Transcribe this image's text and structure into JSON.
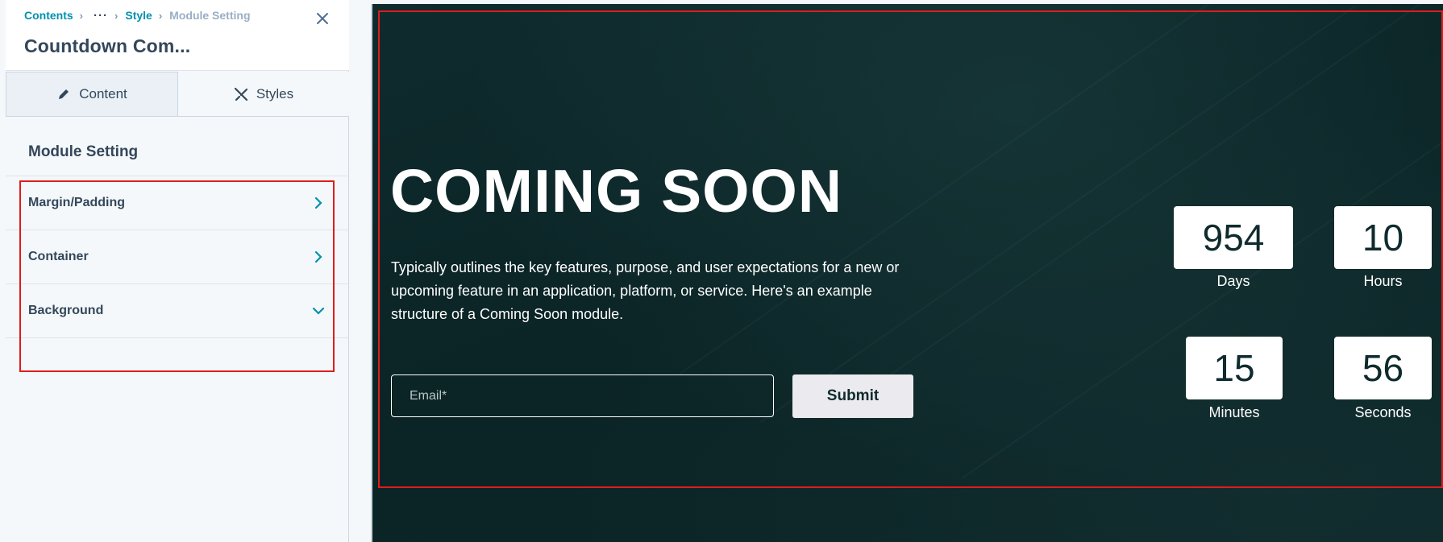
{
  "sidebar": {
    "breadcrumb": {
      "items": [
        "Contents",
        "Style"
      ],
      "ellipsis": "···",
      "current": "Module Setting"
    },
    "title": "Countdown Com...",
    "tabs": [
      {
        "label": "Content",
        "icon": "pencil-icon"
      },
      {
        "label": "Styles",
        "icon": "brush-icon"
      }
    ],
    "section_title": "Module Setting",
    "accordion": [
      {
        "label": "Margin/Padding",
        "state": "collapsed"
      },
      {
        "label": "Container",
        "state": "collapsed"
      },
      {
        "label": "Background",
        "state": "expanded"
      }
    ]
  },
  "preview": {
    "heading": "COMING SOON",
    "description": "Typically outlines the key features, purpose, and user expectations for a new or upcoming feature in an application, platform, or service. Here's an example structure of a Coming Soon module.",
    "email_placeholder": "Email*",
    "submit_label": "Submit",
    "countdown": [
      {
        "value": "954",
        "label": "Days"
      },
      {
        "value": "10",
        "label": "Hours"
      },
      {
        "value": "15",
        "label": "Minutes"
      },
      {
        "value": "56",
        "label": "Seconds"
      }
    ]
  },
  "colors": {
    "accent": "#0091ae",
    "highlight": "#e01c1c",
    "preview_bg": "#0f2b2d"
  }
}
